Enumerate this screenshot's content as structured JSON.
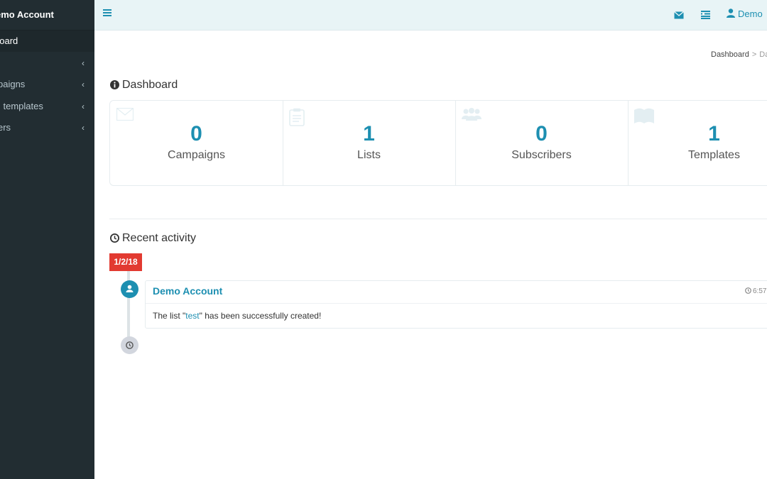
{
  "sidebar": {
    "brand": "emo Account",
    "items": [
      {
        "label": "board",
        "active": true
      },
      {
        "label": "",
        "chevron": "‹"
      },
      {
        "label": "paigns",
        "chevron": "‹"
      },
      {
        "label": "l templates",
        "chevron": "‹"
      },
      {
        "label": "ers",
        "chevron": "‹"
      }
    ]
  },
  "topbar": {
    "user_label": "Demo"
  },
  "breadcrumb": {
    "items": [
      "Dashboard",
      "Da"
    ],
    "separator": ">"
  },
  "dashboard": {
    "title": "Dashboard",
    "stats": [
      {
        "value": "0",
        "label": "Campaigns",
        "icon": "envelope-icon"
      },
      {
        "value": "1",
        "label": "Lists",
        "icon": "clipboard-icon"
      },
      {
        "value": "0",
        "label": "Subscribers",
        "icon": "users-icon"
      },
      {
        "value": "1",
        "label": "Templates",
        "icon": "book-icon"
      }
    ]
  },
  "activity": {
    "title": "Recent activity",
    "date_badge": "1/2/18",
    "entries": [
      {
        "author": "Demo Account",
        "time": "6:57",
        "message_prefix": "The list \"",
        "message_link": "test",
        "message_suffix": "\" has been successfully created!"
      }
    ]
  },
  "colors": {
    "accent": "#1d8fb1",
    "sidebar_bg": "#222d32",
    "topbar_bg": "#e8f4f6",
    "date_badge": "#e23a31"
  }
}
